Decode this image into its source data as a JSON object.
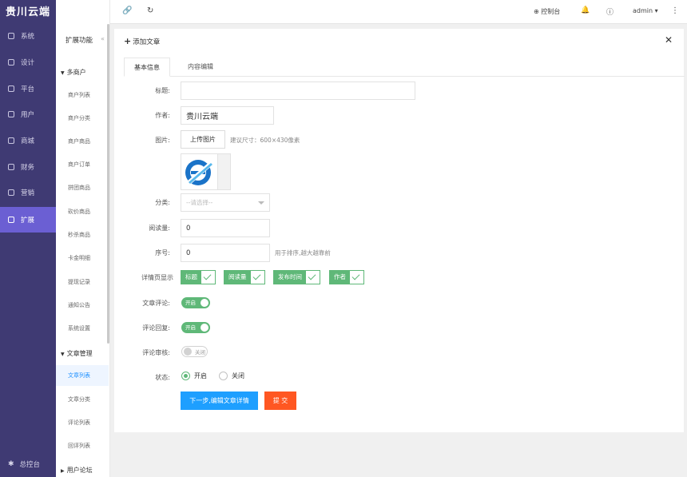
{
  "brand": "贵川云端",
  "sidebar": {
    "items": [
      {
        "label": "系统",
        "icon": "gear-icon"
      },
      {
        "label": "设计",
        "icon": "design-icon"
      },
      {
        "label": "平台",
        "icon": "platform-icon"
      },
      {
        "label": "用户",
        "icon": "user-icon"
      },
      {
        "label": "商城",
        "icon": "mall-icon"
      },
      {
        "label": "财务",
        "icon": "finance-icon"
      },
      {
        "label": "营销",
        "icon": "gift-icon"
      },
      {
        "label": "扩展",
        "icon": "grid-icon"
      }
    ],
    "active": "扩展",
    "bottom_label": "总控台"
  },
  "submenu": {
    "title": "扩展功能",
    "groups": [
      {
        "label": "多商户",
        "links": [
          "商户列表",
          "商户分类",
          "商户商品",
          "商户订单",
          "拼团商品",
          "砍价商品",
          "秒杀商品",
          "卡金明细",
          "提现记录",
          "通知公告",
          "系统设置"
        ]
      },
      {
        "label": "文章管理",
        "links": [
          "文章列表",
          "文章分类",
          "评论列表",
          "回评列表"
        ]
      },
      {
        "label": "用户论坛",
        "links": []
      }
    ],
    "active_link": "文章列表"
  },
  "topbar": {
    "right": {
      "console": "控制台",
      "user": "admin"
    }
  },
  "panel": {
    "title": "添加文章",
    "tabs": [
      "基本信息",
      "内容编辑"
    ],
    "active_tab": "基本信息",
    "form": {
      "title_label": "标题:",
      "title_value": "",
      "author_label": "作者:",
      "author_value": "贵川云端",
      "image_label": "图片:",
      "upload_button": "上传图片",
      "size_hint": "建议尺寸：600×430像素",
      "category_label": "分类:",
      "category_placeholder": "--请选择--",
      "reads_label": "阅读量:",
      "reads_value": "0",
      "sort_label": "序号:",
      "sort_value": "0",
      "sort_hint": "用于排序,越大越靠前",
      "detail_label": "详情页显示",
      "detail_options": [
        "标题",
        "阅读量",
        "发布时间",
        "作者"
      ],
      "comment_label": "文章评论:",
      "comment_switch": "开启",
      "reply_label": "评论回复:",
      "reply_switch": "开启",
      "review_label": "评论审核:",
      "review_switch": "关闭",
      "status_label": "状态:",
      "status_options": [
        "开启",
        "关闭"
      ],
      "status_selected": "开启",
      "next_button": "下一步,编辑文章详情",
      "submit_button": "提 交"
    }
  },
  "colors": {
    "sidebar_bg": "#3f3a73",
    "active_menu": "#6b5fd3",
    "green": "#5fb878",
    "blue": "#1e9fff",
    "orange": "#ff5722"
  }
}
